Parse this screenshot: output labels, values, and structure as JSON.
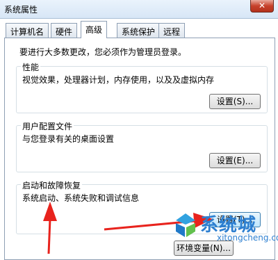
{
  "window": {
    "title": "系统属性",
    "close_glyph": "✕"
  },
  "tabs": [
    {
      "label": "计算机名"
    },
    {
      "label": "硬件"
    },
    {
      "label": "高级",
      "active": true
    },
    {
      "label": "系统保护"
    },
    {
      "label": "远程"
    }
  ],
  "intro": "要进行大多数更改，您必须作为管理员登录。",
  "performance": {
    "legend": "性能",
    "description": "视觉效果，处理器计划，内存使用，以及及虚拟内存",
    "button": "设置(S)..."
  },
  "user_profiles": {
    "legend": "用户配置文件",
    "description": "与您登录有关的桌面设置",
    "button": "设置(E)..."
  },
  "startup_recovery": {
    "legend": "启动和故障恢复",
    "description": "系统启动、系统失败和调试信息",
    "button": "设置(T)..."
  },
  "env_button": "环境变量(N)...",
  "watermark": {
    "text": "系统城",
    "url": "xitongcheng.com"
  },
  "colors": {
    "arrow": "#e8231d",
    "focus": "#3c7fb1",
    "watermark": "#2d7fd0"
  }
}
